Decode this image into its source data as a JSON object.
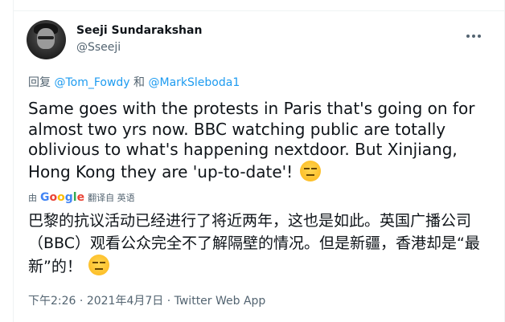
{
  "author": {
    "name": "Seeji Sundarakshan",
    "handle": "@Sseeji"
  },
  "reply": {
    "prefix": "回复",
    "to1": "@Tom_Fowdy",
    "and": "和",
    "to2": "@MarkSleboda1"
  },
  "tweet": {
    "text": "Same goes with the protests in Paris that's going on for almost two yrs now. BBC watching public are totally oblivious to what's happening nextdoor. But Xinjiang, Hong Kong they are 'up-to-date'!",
    "emoji": "unamused-face"
  },
  "translation": {
    "by": "由",
    "provider": "Google",
    "action": "翻译自 英语",
    "text": "巴黎的抗议活动已经进行了将近两年，这也是如此。英国广播公司（BBC）观看公众完全不了解隔壁的情况。但是新疆，香港却是“最新”的！",
    "emoji": "unamused-face"
  },
  "meta": {
    "time": "下午2:26",
    "sep1": "·",
    "date": "2021年4月7日",
    "sep2": "·",
    "source": "Twitter Web App"
  }
}
